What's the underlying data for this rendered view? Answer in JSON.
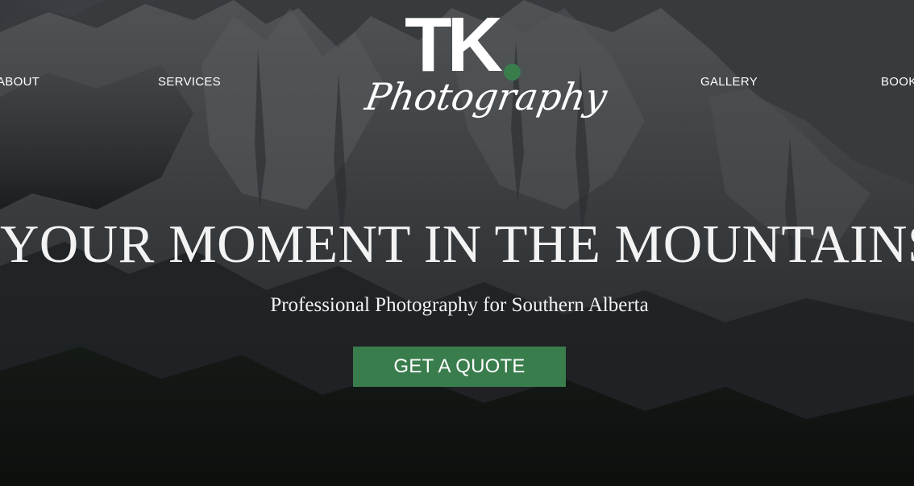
{
  "nav": {
    "items": [
      {
        "label": "ABOUT"
      },
      {
        "label": "SERVICES"
      },
      {
        "label": "GALLERY"
      },
      {
        "label": "BOOK"
      }
    ]
  },
  "logo": {
    "mark": "TK",
    "script": "Photography",
    "dot_color": "#3a7d4d"
  },
  "hero": {
    "headline": "YOUR MOMENT IN THE MOUNTAINS",
    "subheadline": "Professional Photography for Southern Alberta",
    "cta_label": "GET A QUOTE"
  },
  "colors": {
    "accent": "#3a7d4d",
    "text": "#ffffff"
  }
}
